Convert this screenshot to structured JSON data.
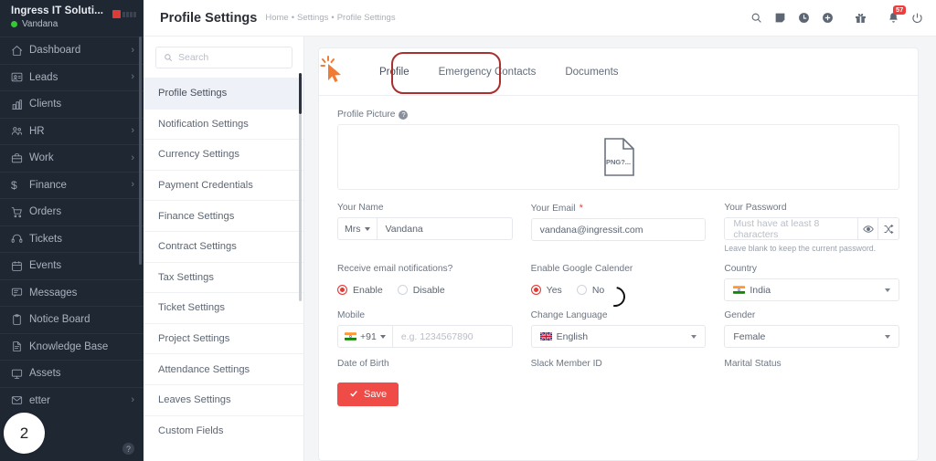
{
  "sidebar": {
    "brand": "Ingress IT Soluti...",
    "user": "Vandana",
    "items": [
      {
        "label": "Dashboard",
        "icon": "home-icon",
        "chevron": "›"
      },
      {
        "label": "Leads",
        "icon": "leads-icon",
        "chevron": "›"
      },
      {
        "label": "Clients",
        "icon": "clients-icon",
        "chevron": ""
      },
      {
        "label": "HR",
        "icon": "hr-icon",
        "chevron": "›"
      },
      {
        "label": "Work",
        "icon": "work-icon",
        "chevron": "›"
      },
      {
        "label": "Finance",
        "icon": "finance-icon",
        "chevron": "›"
      },
      {
        "label": "Orders",
        "icon": "orders-icon",
        "chevron": ""
      },
      {
        "label": "Tickets",
        "icon": "tickets-icon",
        "chevron": ""
      },
      {
        "label": "Events",
        "icon": "events-icon",
        "chevron": ""
      },
      {
        "label": "Messages",
        "icon": "messages-icon",
        "chevron": ""
      },
      {
        "label": "Notice Board",
        "icon": "notice-board-icon",
        "chevron": ""
      },
      {
        "label": "Knowledge Base",
        "icon": "knowledge-base-icon",
        "chevron": ""
      },
      {
        "label": "Assets",
        "icon": "assets-icon",
        "chevron": ""
      },
      {
        "label": "etter",
        "icon": "letter-icon",
        "chevron": "›"
      }
    ],
    "help_glyph": "?"
  },
  "topbar": {
    "title": "Profile Settings",
    "breadcrumb": [
      "Home",
      "Settings",
      "Profile Settings"
    ],
    "breadcrumb_separator": "•",
    "icons": [
      {
        "name": "search-icon"
      },
      {
        "name": "note-icon"
      },
      {
        "name": "clock-icon"
      },
      {
        "name": "plus-circle-icon"
      },
      {
        "name": "gift-icon"
      },
      {
        "name": "bell-icon",
        "badge": "57"
      },
      {
        "name": "power-icon"
      }
    ]
  },
  "settings_nav": {
    "search_placeholder": "Search",
    "items": [
      "Profile Settings",
      "Notification Settings",
      "Currency Settings",
      "Payment Credentials",
      "Finance Settings",
      "Contract Settings",
      "Tax Settings",
      "Ticket Settings",
      "Project Settings",
      "Attendance Settings",
      "Leaves Settings",
      "Custom Fields"
    ],
    "active_index": 0
  },
  "tabs": [
    {
      "label": "Profile",
      "active": true
    },
    {
      "label": "Emergency Contacts",
      "active": false
    },
    {
      "label": "Documents",
      "active": false
    }
  ],
  "form": {
    "profile_picture": {
      "label": "Profile Picture",
      "help_glyph": "?",
      "broken_text": "PNG?..."
    },
    "your_name": {
      "label": "Your Name",
      "salutation": "Mrs",
      "value": "Vandana"
    },
    "your_email": {
      "label": "Your Email",
      "required": "*",
      "value": "vandana@ingressit.com"
    },
    "your_password": {
      "label": "Your Password",
      "placeholder": "Must have at least 8 characters",
      "help": "Leave blank to keep the current password."
    },
    "email_notifications": {
      "label": "Receive email notifications?",
      "options": [
        "Enable",
        "Disable"
      ],
      "selected": "Enable"
    },
    "google_calendar": {
      "label": "Enable Google Calender",
      "options": [
        "Yes",
        "No"
      ],
      "selected": "Yes"
    },
    "country": {
      "label": "Country",
      "value": "India"
    },
    "mobile": {
      "label": "Mobile",
      "dial_code": "+91",
      "placeholder": "e.g. 1234567890"
    },
    "change_language": {
      "label": "Change Language",
      "value": "English"
    },
    "gender": {
      "label": "Gender",
      "value": "Female"
    },
    "date_of_birth": {
      "label": "Date of Birth"
    },
    "slack_member_id": {
      "label": "Slack Member ID"
    },
    "marital_status": {
      "label": "Marital Status"
    },
    "save_button": "Save"
  },
  "annotations": {
    "step_number": "2",
    "highlight_target": "Emergency Contacts",
    "highlight_color": "#a8302e",
    "cursor_color": "#f07b35"
  },
  "colors": {
    "sidebar_bg": "#1f2733",
    "accent_red": "#ef4b47",
    "active_nav_bg": "#eef1f7"
  }
}
